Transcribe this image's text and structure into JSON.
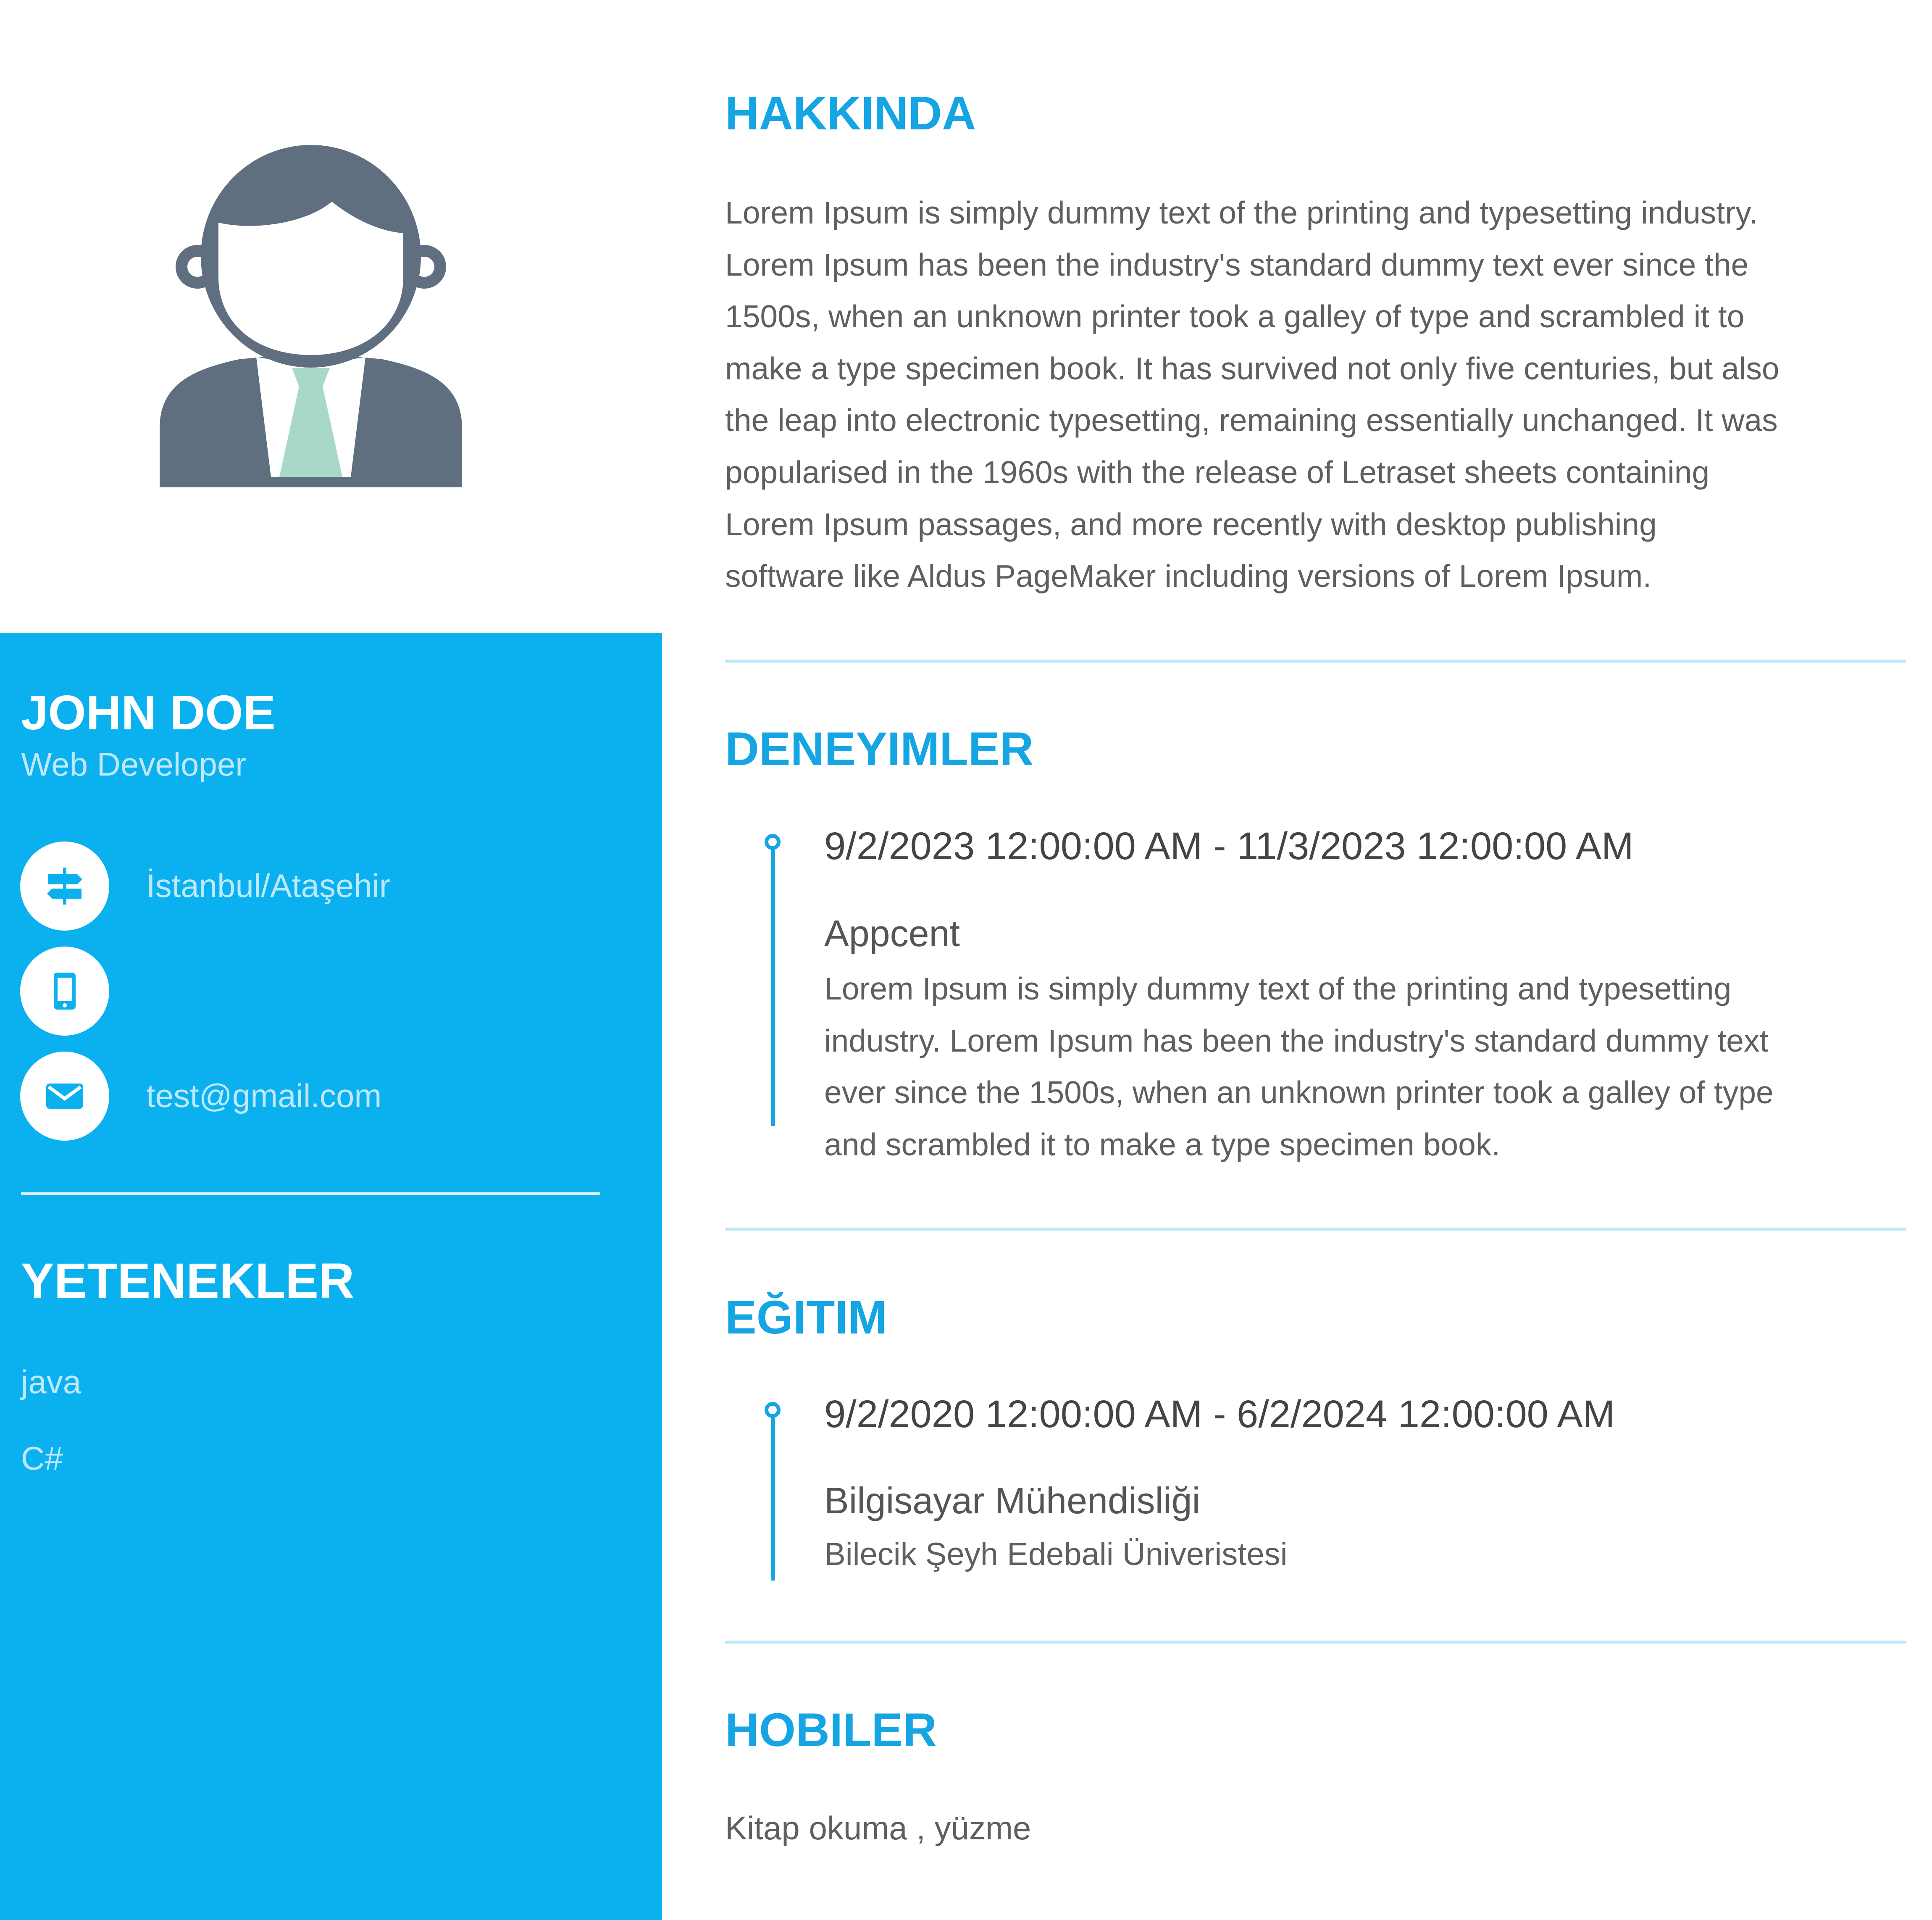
{
  "colors": {
    "accent": "#0bb1ef",
    "heading": "#15a5e3",
    "avatar": "#5f6f80",
    "tie": "#a7d8c8",
    "body_text": "#5f5f5f"
  },
  "profile": {
    "name": "JOHN DOE",
    "role": "Web Developer",
    "contacts": {
      "location": {
        "icon": "signpost-icon",
        "text": "İstanbul/Ataşehir"
      },
      "phone": {
        "icon": "phone-icon",
        "text": ""
      },
      "email": {
        "icon": "envelope-icon",
        "text": "test@gmail.com"
      }
    }
  },
  "skills": {
    "title": "YETENEKLER",
    "items": [
      "java",
      "C#"
    ]
  },
  "about": {
    "title": "HAKKINDA",
    "lines": [
      "Lorem Ipsum is simply dummy text of the printing and typesetting industry.",
      "Lorem Ipsum has been the industry's standard dummy text ever since the",
      "1500s, when an unknown printer took a galley of type and scrambled it to",
      "make a type specimen book. It has survived not only five centuries, but also",
      "the leap into electronic typesetting, remaining essentially unchanged. It was",
      "popularised in the 1960s with the release of Letraset sheets containing",
      "Lorem Ipsum passages, and more recently with desktop publishing",
      "software like Aldus PageMaker including versions of Lorem Ipsum."
    ]
  },
  "experience": {
    "title": "DENEYIMLER",
    "items": [
      {
        "date": "9/2/2023 12:00:00 AM - 11/3/2023 12:00:00 AM",
        "company": "Appcent",
        "description_lines": [
          "Lorem Ipsum is simply dummy text of the printing and typesetting",
          "industry. Lorem Ipsum has been the industry's standard dummy text",
          "ever since the 1500s, when an unknown printer took a galley of type",
          "and scrambled it to make a type specimen book."
        ]
      }
    ]
  },
  "education": {
    "title": "EĞITIM",
    "items": [
      {
        "date": "9/2/2020 12:00:00 AM - 6/2/2024 12:00:00 AM",
        "degree": "Bilgisayar Mühendisliği",
        "school": "Bilecik Şeyh Edebali Üniveristesi"
      }
    ]
  },
  "hobbies": {
    "title": "HOBILER",
    "text": "Kitap okuma , yüzme"
  }
}
